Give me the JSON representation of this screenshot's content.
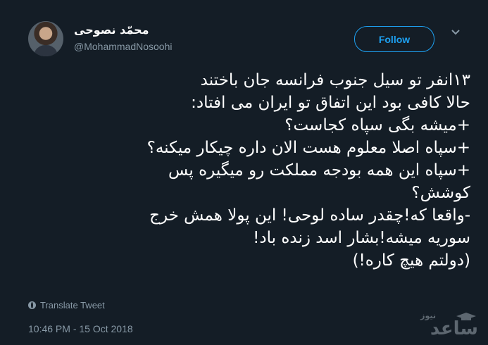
{
  "user": {
    "display_name": "محمّد نصوحی",
    "handle": "@MohammadNosoohi"
  },
  "follow_label": "Follow",
  "tweet": {
    "lines": [
      "۱۳انفر تو سیل جنوب فرانسه جان باختند",
      "حالا کافی بود این اتفاق تو ایران می افتاد:",
      "+میشه بگی سپاه کجاست؟",
      "+سپاه اصلا معلوم هست الان داره چیکار میکنه؟",
      "+سپاه این همه بودجه مملکت رو میگیره پس",
      "کوشش؟",
      "-واقعا که!چقدر ساده لوحی! این پولا همش خرج",
      "سوریه میشه!بشار اسد زنده باد!",
      "(دولتم هیچ کاره!)"
    ]
  },
  "translate_label": "Translate Tweet",
  "timestamp": "10:46 PM - 15 Oct 2018",
  "watermark": {
    "small": "نیوز",
    "big": "ساعد"
  },
  "icons": {
    "menu": "chevron-down-icon",
    "translate": "globe-icon",
    "watermark": "graduation-cap-icon"
  },
  "colors": {
    "background": "#141d26",
    "accent": "#1da1f2",
    "secondary_text": "#8899a6"
  }
}
